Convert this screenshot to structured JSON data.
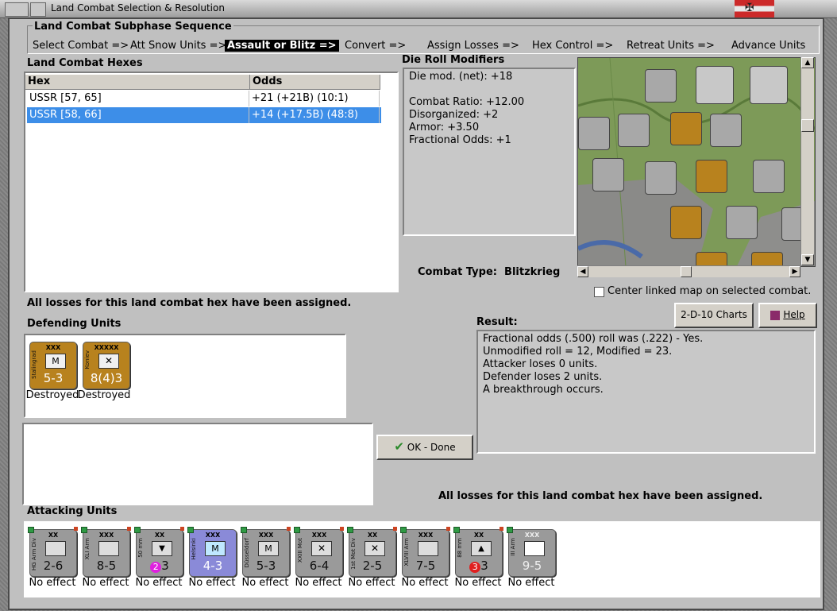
{
  "window": {
    "title": "Land Combat Selection & Resolution"
  },
  "sequence": {
    "title": "Land Combat Subphase Sequence",
    "steps": [
      "Select Combat =>",
      "Att Snow Units =>",
      "Assault or Blitz =>",
      "Convert =>",
      "Assign Losses =>",
      "Hex Control =>",
      "Retreat Units =>",
      "Advance Units"
    ],
    "active_index": 2
  },
  "hexes": {
    "title": "Land Combat Hexes",
    "columns": [
      "Hex",
      "Odds"
    ],
    "rows": [
      {
        "hex": "USSR [57, 65]",
        "odds": "+21 (+21B) (10:1)",
        "selected": false
      },
      {
        "hex": "USSR [58, 66]",
        "odds": "+14 (+17.5B) (48:8)",
        "selected": true
      }
    ]
  },
  "drm": {
    "title": "Die Roll Modifiers",
    "lines": [
      "Die mod. (net): +18",
      "",
      "Combat Ratio: +12.00",
      "Disorganized: +2",
      "Armor: +3.50",
      "Fractional Odds: +1"
    ]
  },
  "combat_type": {
    "label": "Combat Type:",
    "value": "Blitzkrieg"
  },
  "map": {
    "center_checkbox_label": "Center linked map on selected combat.",
    "center_checked": false
  },
  "buttons": {
    "charts": "2-D-10 Charts",
    "help": "Help",
    "ok": "OK - Done"
  },
  "losses_msg": "All losses for this land combat hex have been assigned.",
  "defending": {
    "title": "Defending Units",
    "units": [
      {
        "size": "XXX",
        "name": "Stalingrad",
        "symbol": "M",
        "strength": "5-3",
        "status": "Destroyed",
        "color": "orange"
      },
      {
        "size": "XXXXX",
        "name": "Koniev",
        "symbol": "X",
        "strength": "8(4)3",
        "status": "Destroyed",
        "color": "orange"
      }
    ]
  },
  "result": {
    "title": "Result:",
    "lines": [
      "Fractional odds (.500) roll was (.222)  - Yes.",
      "Unmodified roll = 12, Modified = 23.",
      "Attacker loses 0 units.",
      "Defender loses 2 units.",
      "A breakthrough occurs."
    ]
  },
  "attacking": {
    "title": "Attacking Units",
    "units": [
      {
        "size": "XX",
        "name": "HG Arm Div",
        "strength": "2-6",
        "status": "No effect",
        "color": "grey",
        "badge": ""
      },
      {
        "size": "XXX",
        "name": "XLI Arm",
        "strength": "8-5",
        "status": "No effect",
        "color": "grey",
        "badge": ""
      },
      {
        "size": "XX",
        "name": "50 mm",
        "strength": "3",
        "status": "No effect",
        "color": "grey",
        "badge": "2"
      },
      {
        "size": "XXX",
        "name": "Helsinki",
        "strength": "4-3",
        "status": "No effect",
        "color": "purple",
        "badge": ""
      },
      {
        "size": "XXX",
        "name": "Düsseldorf",
        "strength": "5-3",
        "status": "No effect",
        "color": "grey",
        "badge": ""
      },
      {
        "size": "XXX",
        "name": "XXIII Mot",
        "strength": "6-4",
        "status": "No effect",
        "color": "grey",
        "badge": ""
      },
      {
        "size": "XX",
        "name": "1st Mot Div",
        "strength": "2-5",
        "status": "No effect",
        "color": "grey",
        "badge": ""
      },
      {
        "size": "XXX",
        "name": "XLVIII Arm",
        "strength": "7-5",
        "status": "No effect",
        "color": "grey",
        "badge": ""
      },
      {
        "size": "XX",
        "name": "88 mm",
        "strength": "3",
        "status": "No effect",
        "color": "grey",
        "badge": "3"
      },
      {
        "size": "XXX",
        "name": "III Arm",
        "strength": "9-5",
        "status": "No effect",
        "color": "grey",
        "badge": ""
      }
    ]
  }
}
